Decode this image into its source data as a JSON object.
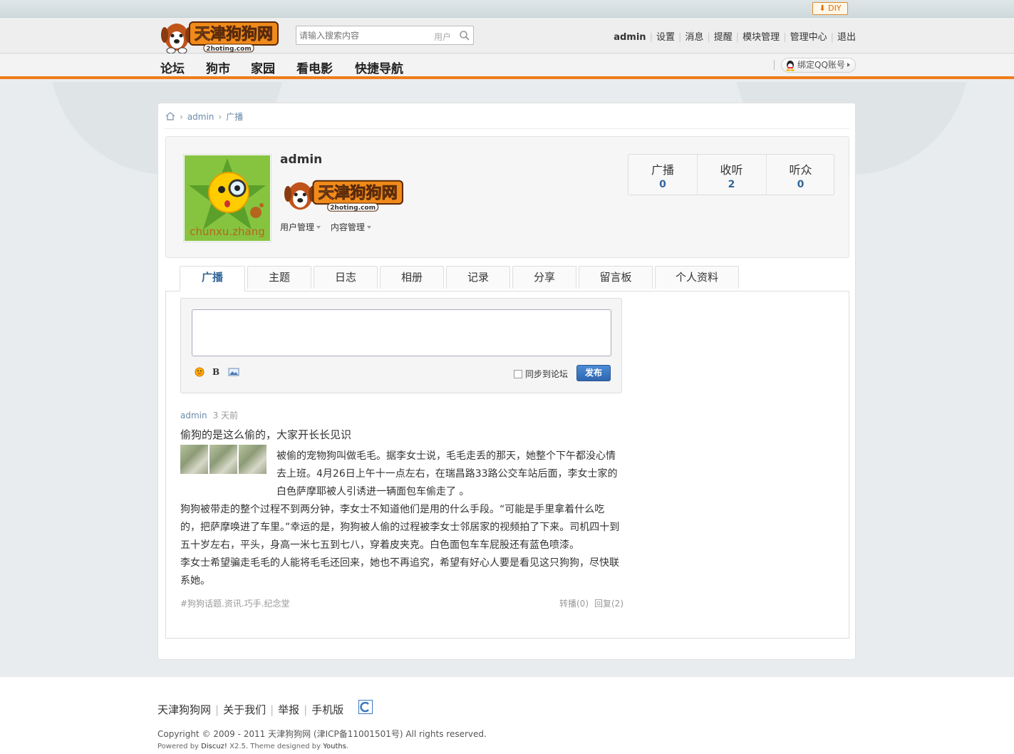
{
  "topbar": {
    "diy_label": "DIY"
  },
  "header": {
    "logo_text": "天津狗狗网",
    "logo_sub": "2hoting.com",
    "search_placeholder": "请输入搜索内容",
    "search_scope": "用户",
    "user": {
      "name": "admin",
      "links": [
        "设置",
        "消息",
        "提醒",
        "模块管理",
        "管理中心",
        "退出"
      ]
    }
  },
  "nav": {
    "items": [
      "论坛",
      "狗市",
      "家园",
      "看电影",
      "快捷导航"
    ],
    "qq_bind": "绑定QQ账号"
  },
  "breadcrumb": {
    "user": "admin",
    "current": "广播"
  },
  "profile": {
    "name": "admin",
    "avatar_caption": "chunxu.zhang",
    "menu": [
      "用户管理",
      "内容管理"
    ],
    "stats": [
      {
        "label": "广播",
        "value": "0"
      },
      {
        "label": "收听",
        "value": "2"
      },
      {
        "label": "听众",
        "value": "0"
      }
    ]
  },
  "tabs": [
    "广播",
    "主题",
    "日志",
    "相册",
    "记录",
    "分享",
    "留言板",
    "个人资料"
  ],
  "composer": {
    "sync_label": "同步到论坛",
    "publish_label": "发布",
    "bold_label": "B"
  },
  "feed": {
    "author": "admin",
    "time": "3 天前",
    "title": "偷狗的是这么偷的，大家开长长见识",
    "paragraph1": "被偷的宠物狗叫做毛毛。据李女士说，毛毛走丢的那天，她整个下午都没心情去上班。4月26日上午十一点左右，在瑞昌路33路公交车站后面，李女士家的白色萨摩耶被人引诱进一辆面包车偷走了 。",
    "paragraph2": "狗狗被带走的整个过程不到两分钟，李女士不知道他们是用的什么手段。“可能是手里拿着什么吃的，把萨摩唤进了车里。”幸运的是，狗狗被人偷的过程被李女士邻居家的视频拍了下来。司机四十到五十岁左右，平头，身高一米七五到七八，穿着皮夹克。白色面包车车屁股还有蓝色喷漆。",
    "paragraph3": "李女士希望骗走毛毛的人能将毛毛还回来，她也不再追究，希望有好心人要是看见这只狗狗，尽快联系她。",
    "tags": "#狗狗话题.资讯.巧手.纪念堂",
    "forward": "转播(0)",
    "reply": "回复(2)"
  },
  "footer": {
    "links": [
      "天津狗狗网",
      "关于我们",
      "举报",
      "手机版"
    ],
    "copyright": "Copyright © 2009 - 2011 天津狗狗网 (津ICP备11001501号) All rights reserved.",
    "powered_prefix": "Powered by ",
    "powered_discuz": "Discuz!",
    "powered_mid": " X2.5. Theme designed by ",
    "powered_youths": "Youths",
    "powered_end": "."
  },
  "colors": {
    "accent": "#f07c1a",
    "link": "#336699",
    "button": "#2f66b0"
  }
}
